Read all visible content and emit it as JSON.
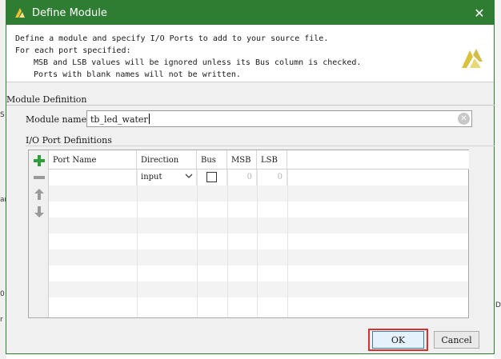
{
  "window": {
    "title": "Define Module",
    "close_glyph": "✕"
  },
  "banner": {
    "lines": [
      "Define a module and specify I/O Ports to add to your source file.",
      "For each port specified:",
      "MSB and LSB values will be ignored unless its Bus column is checked.",
      "Ports with blank names will not be written."
    ]
  },
  "module_definition": {
    "section_title": "Module Definition",
    "name_label": "Module name:",
    "name_value": "tb_led_water"
  },
  "ports": {
    "section_title": "I/O Port Definitions",
    "columns": [
      "Port Name",
      "Direction",
      "Bus",
      "MSB",
      "LSB"
    ],
    "rows": [
      {
        "port_name": "",
        "direction": "input",
        "bus": false,
        "msb": "0",
        "lsb": "0"
      }
    ]
  },
  "buttons": {
    "ok": "OK",
    "cancel": "Cancel"
  },
  "icons": {
    "add": "plus-icon",
    "remove": "minus-icon",
    "up": "arrow-up-icon",
    "down": "arrow-down-icon",
    "clear": "clear-circle-icon"
  },
  "background_fragments": [
    "S",
    "0",
    "r",
    "an",
    "DS"
  ]
}
